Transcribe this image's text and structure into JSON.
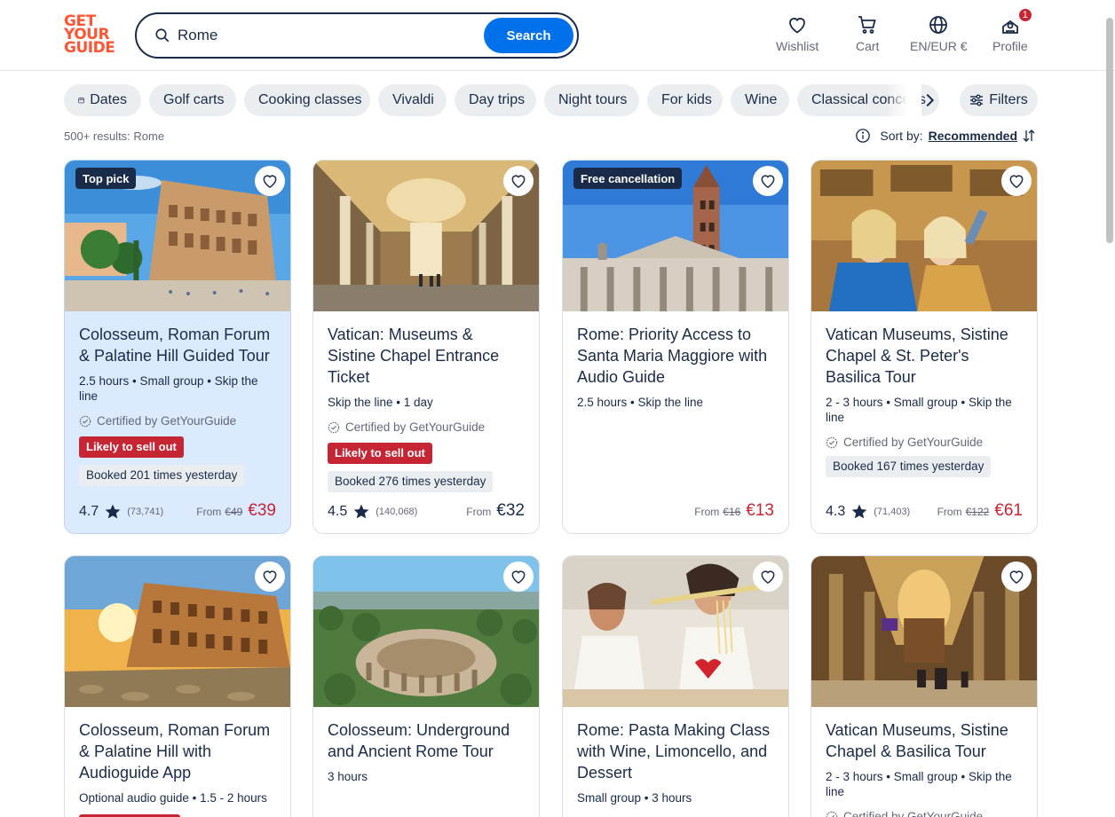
{
  "header": {
    "logo_lines": [
      "GET",
      "YOUR",
      "GUIDE"
    ],
    "search_value": "Rome",
    "search_button": "Search",
    "nav": [
      {
        "label": "Wishlist",
        "icon": "heart-icon"
      },
      {
        "label": "Cart",
        "icon": "cart-icon"
      },
      {
        "label": "EN/EUR €",
        "icon": "globe-icon"
      },
      {
        "label": "Profile",
        "icon": "profile-icon",
        "badge": "1"
      }
    ]
  },
  "chips": [
    "Dates",
    "Golf carts",
    "Cooking classes",
    "Vivaldi",
    "Day trips",
    "Night tours",
    "For kids",
    "Wine",
    "Classical concerts"
  ],
  "filters_label": "Filters",
  "results_text": "500+ results: Rome",
  "sort": {
    "label": "Sort by:",
    "value": "Recommended"
  },
  "colors": {
    "brand": "#ff5533",
    "accent": "#0071eb",
    "navy": "#1a2b49",
    "sale_red": "#c62533",
    "highlight_card": "#dbeafe"
  },
  "cards": [
    {
      "tag": "Top pick",
      "title": "Colosseum, Roman Forum & Palatine Hill Guided Tour",
      "meta": "2.5 hours • Small group • Skip the line",
      "certified": "Certified by GetYourGuide",
      "sell": "Likely to sell out",
      "booked": "Booked 201 times yesterday",
      "rating": "4.7",
      "reviews": "(73,741)",
      "from": "From",
      "old_price": "€49",
      "price": "€39"
    },
    {
      "tag": "",
      "title": "Vatican: Museums & Sistine Chapel Entrance Ticket",
      "meta": "Skip the line • 1 day",
      "certified": "Certified by GetYourGuide",
      "sell": "Likely to sell out",
      "booked": "Booked 276 times yesterday",
      "rating": "4.5",
      "reviews": "(140,068)",
      "from": "From",
      "old_price": "",
      "price": "€32"
    },
    {
      "tag": "Free cancellation",
      "title": "Rome: Priority Access to Santa Maria Maggiore with Audio Guide",
      "meta": "2.5 hours • Skip the line",
      "certified": "",
      "sell": "",
      "booked": "",
      "rating": "",
      "reviews": "",
      "from": "From",
      "old_price": "€16",
      "price": "€13"
    },
    {
      "tag": "",
      "title": "Vatican Museums, Sistine Chapel & St. Peter's Basilica Tour",
      "meta": "2 - 3 hours • Small group • Skip the line",
      "certified": "Certified by GetYourGuide",
      "sell": "",
      "booked": "Booked 167 times yesterday",
      "rating": "4.3",
      "reviews": "(71,403)",
      "from": "From",
      "old_price": "€122",
      "price": "€61"
    },
    {
      "tag": "",
      "title": "Colosseum, Roman Forum & Palatine Hill with Audioguide App",
      "meta": "Optional audio guide • 1.5 - 2 hours"
    },
    {
      "tag": "",
      "title": "Colosseum: Underground and Ancient Rome Tour",
      "meta": "3 hours"
    },
    {
      "tag": "",
      "title": "Rome: Pasta Making Class with Wine, Limoncello, and Dessert",
      "meta": "Small group • 3 hours"
    },
    {
      "tag": "",
      "title": "Vatican Museums, Sistine Chapel & Basilica Tour",
      "meta": "2 - 3 hours • Small group • Skip the line",
      "certified": "Certified by GetYourGuide"
    }
  ]
}
